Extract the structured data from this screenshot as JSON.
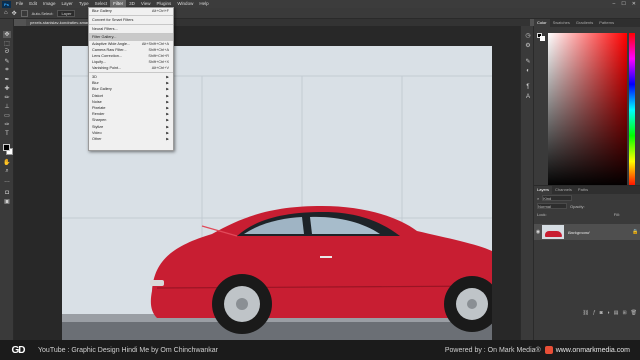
{
  "menubar": {
    "items": [
      "File",
      "Edit",
      "Image",
      "Layer",
      "Type",
      "Select",
      "Filter",
      "3D",
      "View",
      "Plugins",
      "Window",
      "Help"
    ],
    "active": "Filter"
  },
  "options_bar": {
    "auto_select_label": "Auto-Select:",
    "layer_value": "Layer"
  },
  "document": {
    "tab_title": "pexels-stanislav-kondratiev-smart..."
  },
  "filter_menu": {
    "items": [
      {
        "label": "Blur Gallery",
        "shortcut": "Alt+Ctrl+F",
        "type": "item"
      },
      {
        "type": "sep"
      },
      {
        "label": "Convert for Smart Filters",
        "shortcut": "",
        "type": "item"
      },
      {
        "type": "sep"
      },
      {
        "label": "Neural Filters...",
        "shortcut": "",
        "type": "item"
      },
      {
        "type": "sep"
      },
      {
        "label": "Filter Gallery...",
        "shortcut": "",
        "type": "item",
        "highlight": true
      },
      {
        "label": "Adaptive Wide Angle...",
        "shortcut": "Alt+Shift+Ctrl+A",
        "type": "item"
      },
      {
        "label": "Camera Raw Filter...",
        "shortcut": "Shift+Ctrl+A",
        "type": "item"
      },
      {
        "label": "Lens Correction...",
        "shortcut": "Shift+Ctrl+R",
        "type": "item"
      },
      {
        "label": "Liquify...",
        "shortcut": "Shift+Ctrl+X",
        "type": "item"
      },
      {
        "label": "Vanishing Point...",
        "shortcut": "Alt+Ctrl+V",
        "type": "item"
      },
      {
        "type": "sep"
      },
      {
        "label": "3D",
        "submenu": true,
        "type": "item"
      },
      {
        "label": "Blur",
        "submenu": true,
        "type": "item"
      },
      {
        "label": "Blur Gallery",
        "submenu": true,
        "type": "item"
      },
      {
        "label": "Distort",
        "submenu": true,
        "type": "item"
      },
      {
        "label": "Noise",
        "submenu": true,
        "type": "item"
      },
      {
        "label": "Pixelate",
        "submenu": true,
        "type": "item"
      },
      {
        "label": "Render",
        "submenu": true,
        "type": "item"
      },
      {
        "label": "Sharpen",
        "submenu": true,
        "type": "item"
      },
      {
        "label": "Stylize",
        "submenu": true,
        "type": "item"
      },
      {
        "label": "Video",
        "submenu": true,
        "type": "item"
      },
      {
        "label": "Other",
        "submenu": true,
        "type": "item"
      }
    ]
  },
  "color_panel": {
    "tabs": [
      "Color",
      "Swatches",
      "Gradients",
      "Patterns"
    ],
    "active_tab": "Color"
  },
  "layers_panel": {
    "tabs": [
      "Layers",
      "Channels",
      "Paths"
    ],
    "active_tab": "Layers",
    "kind_label": "Kind",
    "blend_mode": "Normal",
    "opacity_label": "Opacity:",
    "lock_label": "Lock:",
    "fill_label": "Fill:",
    "layer_name": "Background"
  },
  "footer": {
    "logo_text": "GD",
    "left_text": "YouTube : Graphic Design Hindi Me by Om Chinchwankar",
    "right_text": "Powered by : On Mark Media®",
    "url": "www.onmarkmedia.com"
  },
  "colors": {
    "app_bg": "#535353",
    "panel_bg": "#3a3a3a",
    "car_red": "#c81e32",
    "wall": "#d6dde3"
  },
  "icons": {
    "tools": [
      "move-icon",
      "marquee-icon",
      "lasso-icon",
      "quick-select-icon",
      "crop-icon",
      "frame-icon",
      "eyedropper-icon",
      "healing-icon",
      "brush-icon",
      "stamp-icon",
      "history-brush-icon",
      "eraser-icon",
      "gradient-icon",
      "blur-tool-icon",
      "dodge-icon",
      "pen-icon",
      "type-icon",
      "path-select-icon",
      "shape-icon",
      "hand-icon",
      "zoom-icon",
      "more-tools-icon"
    ]
  }
}
